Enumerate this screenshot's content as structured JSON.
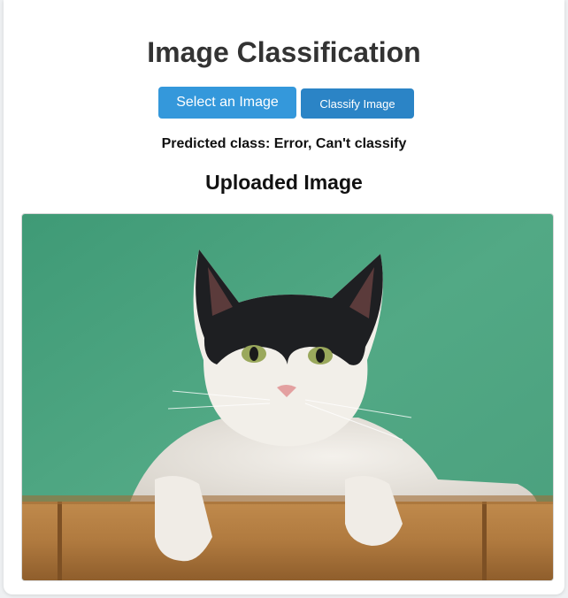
{
  "page": {
    "title": "Image Classification",
    "subtitle": "Uploaded Image"
  },
  "buttons": {
    "select_label": "Select an Image",
    "classify_label": "Classify Image"
  },
  "prediction": {
    "text": "Predicted class: Error, Can't classify"
  },
  "image": {
    "alt": "uploaded cat photo",
    "description_icon": "cat-photo"
  },
  "colors": {
    "primary_button": "#3498db",
    "secondary_button": "#2b84c6",
    "title_text": "#333333",
    "background_wall": "#4fa683",
    "bamboo": "#b07a3f"
  }
}
